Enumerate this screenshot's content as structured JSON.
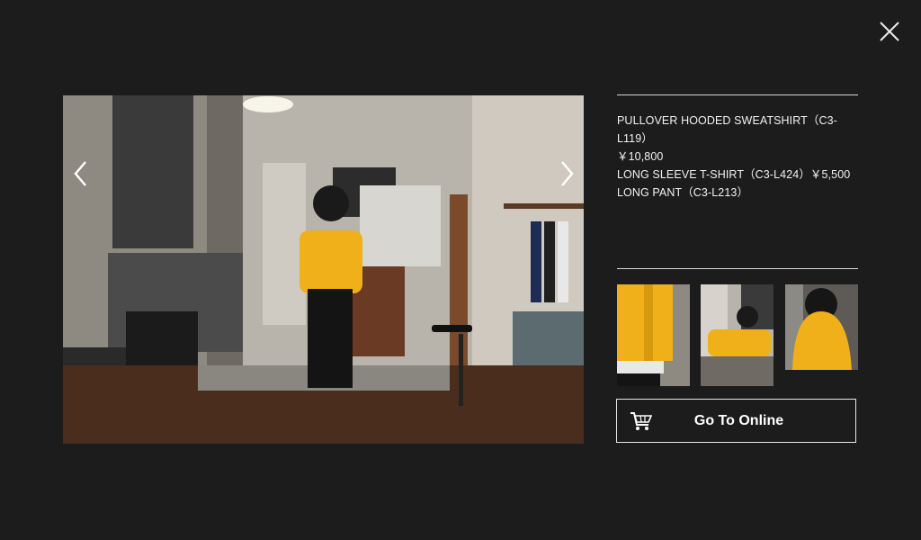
{
  "modal": {
    "close_icon": "close-icon",
    "prev_icon": "chevron-left-icon",
    "next_icon": "chevron-right-icon"
  },
  "product": {
    "items": [
      "PULLOVER HOODED SWEATSHIRT（C3-L119）",
      "￥10,800",
      "LONG SLEEVE T-SHIRT（C3-L424）￥5,500",
      "LONG PANT（C3-L213）"
    ]
  },
  "cta": {
    "label": "Go To Online",
    "icon": "shopping-cart-icon"
  },
  "colors": {
    "background": "#1c1c1c",
    "accent_yellow": "#f0b01a"
  }
}
